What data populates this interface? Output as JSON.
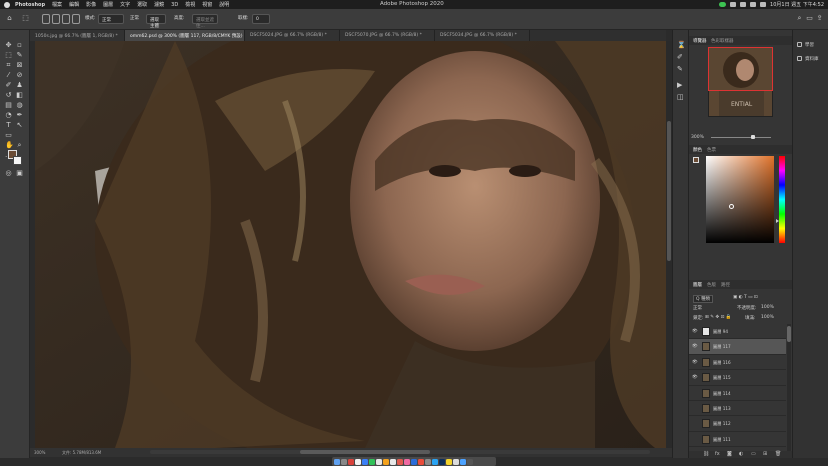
{
  "menubar": {
    "app": "Photoshop",
    "items": [
      "檔案",
      "編輯",
      "影像",
      "圖層",
      "文字",
      "選取",
      "濾鏡",
      "3D",
      "檢視",
      "視窗",
      "說明"
    ],
    "window_title": "Adobe Photoshop 2020",
    "clock": "10月1日 週五 下午4:52"
  },
  "options_bar": {
    "feather_label": "羽化:",
    "feather_value": "0 像素",
    "style_label": "樣式:",
    "style_value": "正常",
    "width_label": "寬度:",
    "height_label": "高度:",
    "select_subject": "選取主體",
    "select_mask": "選取並遮住...",
    "mode_value": "正常",
    "sample_label": "取樣:",
    "sample_value": "0"
  },
  "tabs": [
    {
      "label": "1050s.jpg @ 66.7% (圖層 1, RGB/8) *",
      "active": false
    },
    {
      "label": "omm62.psd @ 300% (圖層 117, RGB/8/CMYK 預設) *",
      "active": true
    },
    {
      "label": "DSCF5024.JPG @ 66.7% (RGB/8) *",
      "active": false
    },
    {
      "label": "DSCF5070.JPG @ 66.7% (RGB/8) *",
      "active": false
    },
    {
      "label": "DSCF5034.JPG @ 66.7% (RGB/8) *",
      "active": false
    }
  ],
  "status": {
    "zoom": "300%",
    "doc_info": "文件: 5.78M/813.6M"
  },
  "navigator": {
    "tabs": [
      "導覽器",
      "色彩取樣器"
    ],
    "zoom": "300%",
    "thumb_text": "ENTIAL"
  },
  "color": {
    "tabs": [
      "顏色",
      "色票"
    ]
  },
  "layers": {
    "tabs": [
      "圖層",
      "色版",
      "路徑"
    ],
    "filter_label": "Q 種類",
    "blend_mode": "正常",
    "opacity_label": "不透明度:",
    "opacity_value": "100%",
    "lock_label": "鎖定:",
    "fill_label": "填滿:",
    "fill_value": "100%",
    "list": [
      {
        "name": "圖層 94",
        "visible": true,
        "selected": false,
        "white": true
      },
      {
        "name": "圖層 117",
        "visible": true,
        "selected": true,
        "white": false
      },
      {
        "name": "圖層 116",
        "visible": true,
        "selected": false,
        "white": false
      },
      {
        "name": "圖層 115",
        "visible": true,
        "selected": false,
        "white": false
      },
      {
        "name": "圖層 114",
        "visible": false,
        "selected": false,
        "white": false
      },
      {
        "name": "圖層 113",
        "visible": false,
        "selected": false,
        "white": false
      },
      {
        "name": "圖層 112",
        "visible": false,
        "selected": false,
        "white": false
      },
      {
        "name": "圖層 111",
        "visible": false,
        "selected": false,
        "white": false
      },
      {
        "name": "圖層 110",
        "visible": false,
        "selected": false,
        "white": false
      },
      {
        "name": "圖層 109",
        "visible": false,
        "selected": false,
        "white": false
      },
      {
        "name": "圖層 108",
        "visible": false,
        "selected": false,
        "white": false
      }
    ]
  },
  "right_panel": {
    "items": [
      "學習",
      "資料庫"
    ]
  },
  "colors": {
    "accent_orange": "#e0722a",
    "nav_box": "#dd3333",
    "status_green": "#3cc252"
  }
}
